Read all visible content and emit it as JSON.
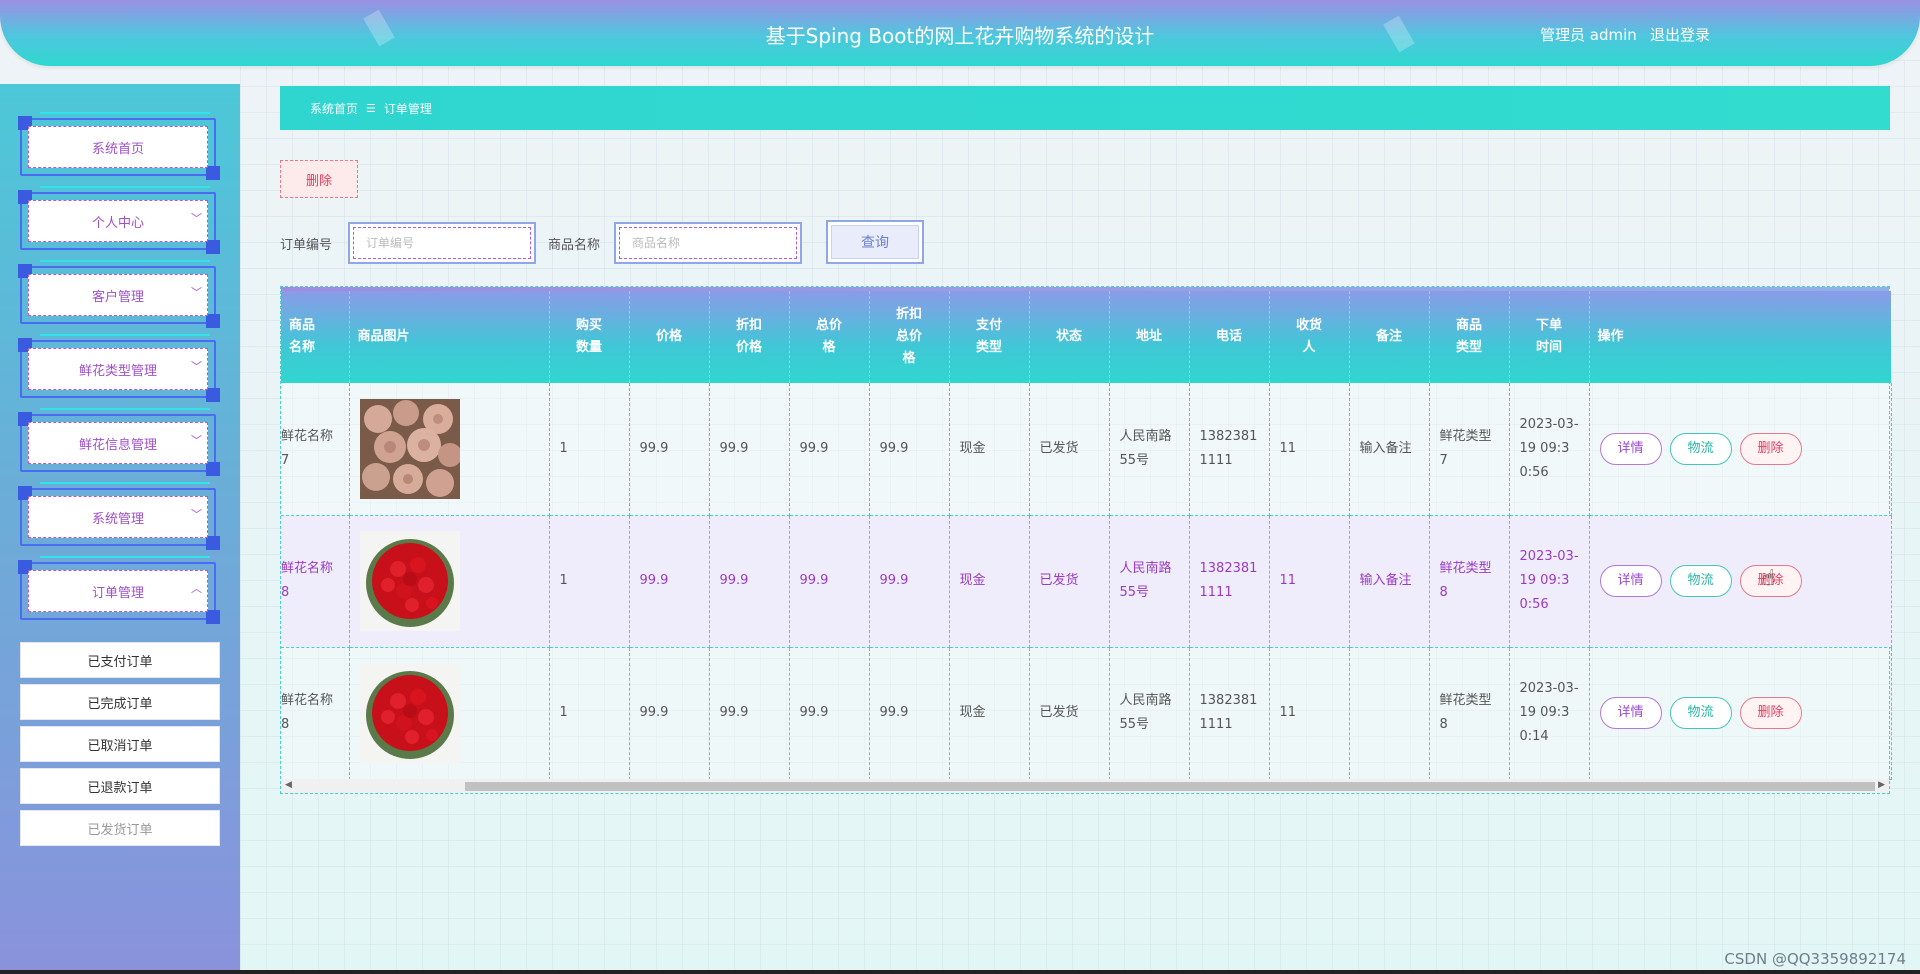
{
  "header": {
    "title": "基于Sping Boot的网上花卉购物系统的设计",
    "user": "管理员 admin",
    "logout": "退出登录"
  },
  "sidebar": {
    "items": [
      {
        "label": "系统首页",
        "chevron": ""
      },
      {
        "label": "个人中心",
        "chevron": "﹀"
      },
      {
        "label": "客户管理",
        "chevron": "﹀"
      },
      {
        "label": "鲜花类型管理",
        "chevron": "﹀"
      },
      {
        "label": "鲜花信息管理",
        "chevron": "﹀"
      },
      {
        "label": "系统管理",
        "chevron": "﹀"
      },
      {
        "label": "订单管理",
        "chevron": "︿"
      }
    ],
    "sub_items": [
      {
        "label": "已支付订单"
      },
      {
        "label": "已完成订单"
      },
      {
        "label": "已取消订单"
      },
      {
        "label": "已退款订单"
      },
      {
        "label": "已发货订单"
      }
    ]
  },
  "breadcrumb": {
    "home": "系统首页",
    "sep": "☰",
    "current": "订单管理"
  },
  "toolbar": {
    "delete_label": "删除"
  },
  "search": {
    "order_no_label": "订单编号",
    "order_no_placeholder": "订单编号",
    "product_label": "商品名称",
    "product_placeholder": "商品名称",
    "query_label": "查询"
  },
  "table": {
    "headers": [
      "商品\n名称",
      "商品图片",
      "购买\n数量",
      "价格",
      "折扣\n价格",
      "总价\n格",
      "折扣\n总价\n格",
      "支付\n类型",
      "状态",
      "地址",
      "电话",
      "收货\n人",
      "备注",
      "商品\n类型",
      "下单\n时间",
      "操作"
    ],
    "rows": [
      {
        "name": "鲜花名称7",
        "image": "pink-roses",
        "qty": "1",
        "price": "99.9",
        "disc_price": "99.9",
        "total": "99.9",
        "disc_total": "99.9",
        "pay_type": "现金",
        "status": "已发货",
        "address": "人民南路55号",
        "phone": "13823811111",
        "receiver": "11",
        "remark": "输入备注",
        "type": "鲜花类型7",
        "time": "2023-03-19 09:30:56"
      },
      {
        "name": "鲜花名称8",
        "image": "red-roses",
        "qty": "1",
        "price": "99.9",
        "disc_price": "99.9",
        "total": "99.9",
        "disc_total": "99.9",
        "pay_type": "现金",
        "status": "已发货",
        "address": "人民南路55号",
        "phone": "13823811111",
        "receiver": "11",
        "remark": "输入备注",
        "type": "鲜花类型8",
        "time": "2023-03-19 09:30:56"
      },
      {
        "name": "鲜花名称8",
        "image": "red-roses",
        "qty": "1",
        "price": "99.9",
        "disc_price": "99.9",
        "total": "99.9",
        "disc_total": "99.9",
        "pay_type": "现金",
        "status": "已发货",
        "address": "人民南路55号",
        "phone": "13823811111",
        "receiver": "11",
        "remark": "",
        "type": "鲜花类型8",
        "time": "2023-03-19 09:30:14"
      }
    ],
    "ops": {
      "detail": "详情",
      "logistics": "物流",
      "delete": "删除"
    }
  },
  "watermark": "CSDN @QQ3359892174",
  "colors": {
    "accent_teal": "#2ed8cf",
    "accent_purple": "#9b8fe4",
    "delete_red": "#e04060"
  }
}
